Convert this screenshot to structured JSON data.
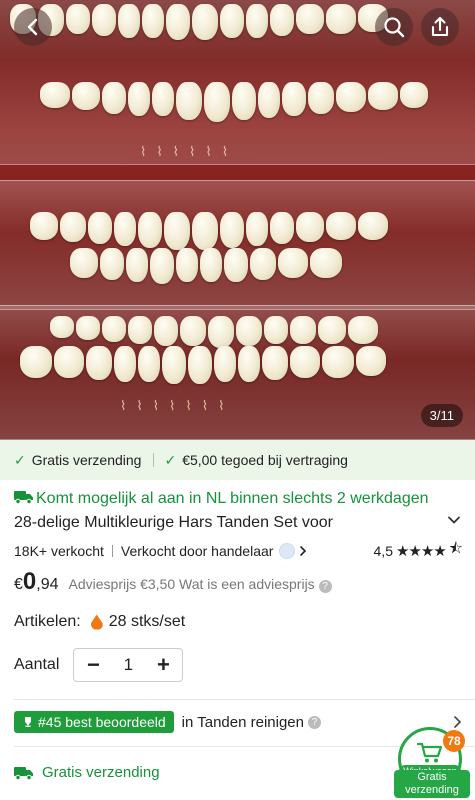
{
  "hero": {
    "image_counter": "3/11"
  },
  "benefits": {
    "free_shipping": "Gratis verzending",
    "credit": "€5,00 tegoed bij vertraging"
  },
  "product": {
    "delivery_note": "Komt mogelijk al aan in NL binnen slechts 2 werkdagen",
    "title": "28-delige Multikleurige Hars Tanden Set voor",
    "sold_count": "18K+ verkocht",
    "seller_label": "Verkocht door handelaar",
    "rating": "4,5",
    "rating_value": 4.5,
    "price_currency": "€",
    "price_int": "0",
    "price_dec": ",94",
    "advice_price": "Adviesprijs €3,50",
    "advice_question": "Wat is een adviesprijs",
    "articles_label": "Artikelen:",
    "articles_value": "28 stks/set",
    "quantity_label": "Aantal",
    "quantity_value": "1"
  },
  "ranking": {
    "badge": "#45 best beoordeeld",
    "category": "in Tanden reinigen"
  },
  "shipping": {
    "label": "Gratis verzending"
  },
  "cart": {
    "count": "78",
    "label": "Winkelwagen",
    "free_label": "Gratis verzending"
  },
  "colors": {
    "green": "#1f9d3a",
    "orange": "#f07a10"
  }
}
